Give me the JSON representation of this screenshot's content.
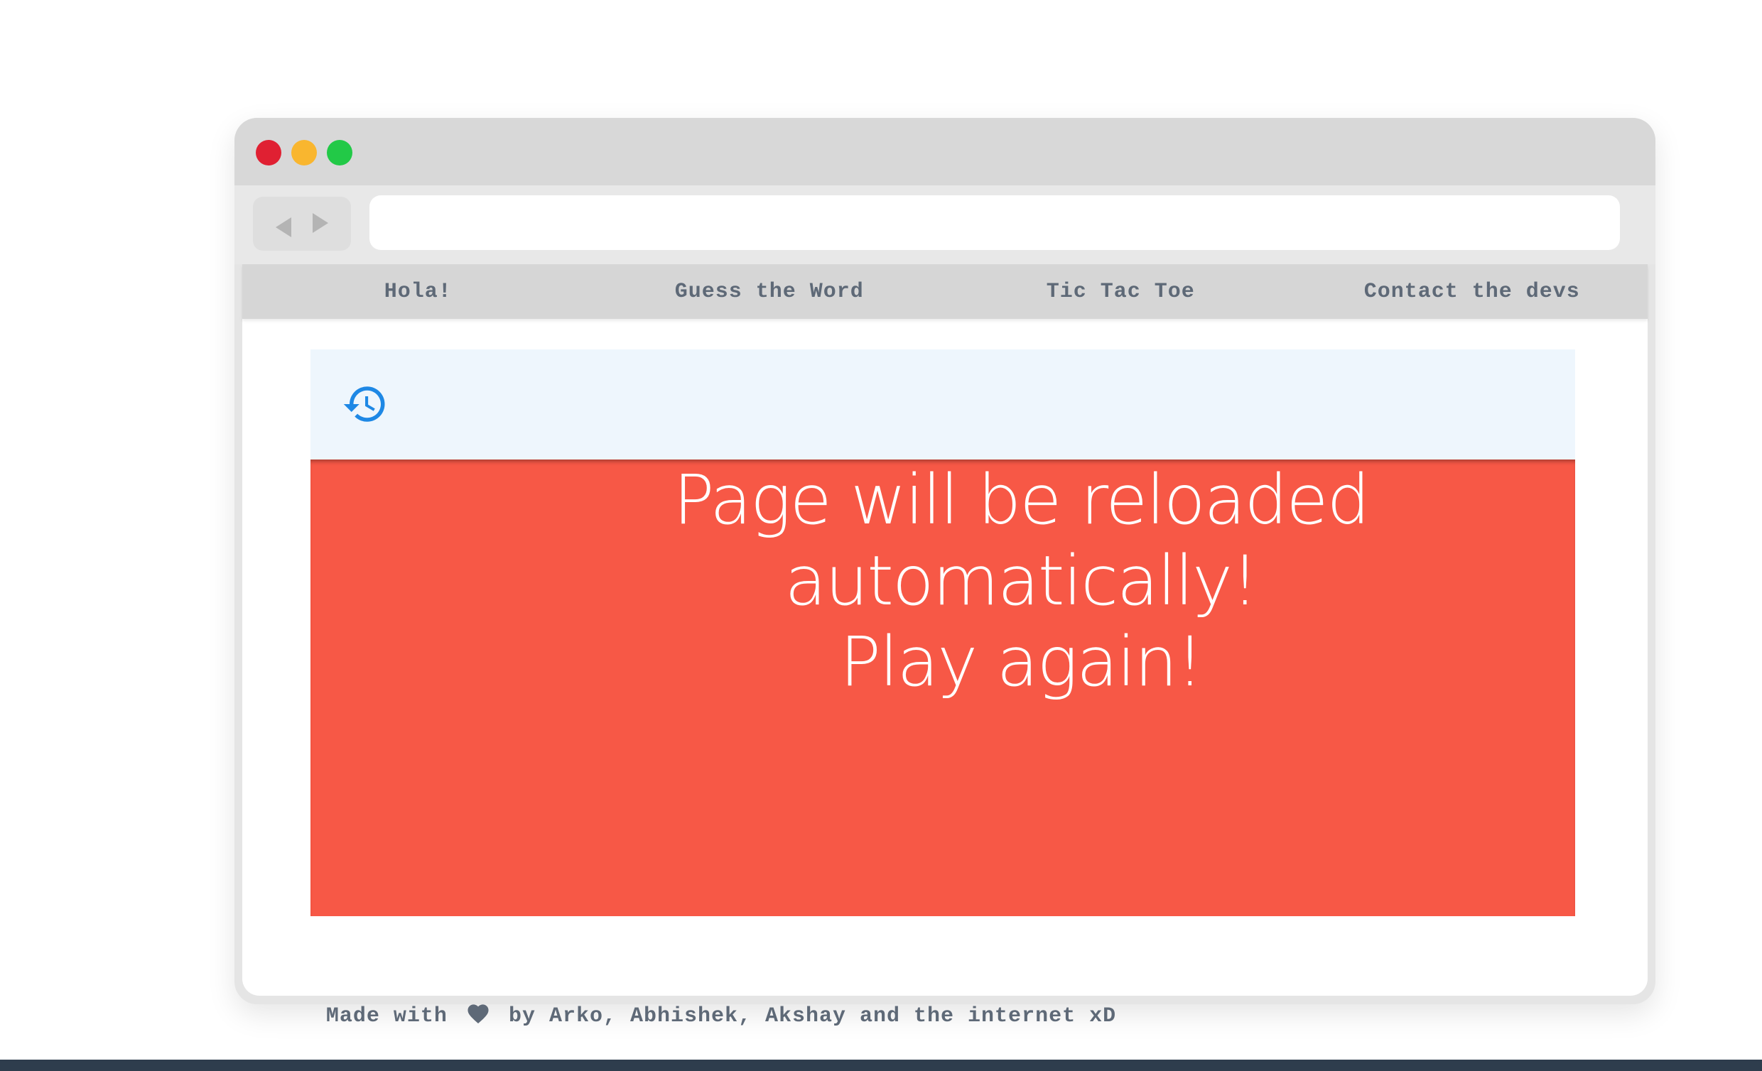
{
  "window": {
    "controls": [
      "close",
      "minimize",
      "maximize"
    ],
    "nav_icons": [
      "back-arrow-icon",
      "forward-arrow-icon"
    ],
    "address_value": ""
  },
  "nav": {
    "items": [
      {
        "label": "Hola!"
      },
      {
        "label": "Guess the Word"
      },
      {
        "label": "Tic Tac Toe"
      },
      {
        "label": "Contact the devs"
      }
    ]
  },
  "game": {
    "header_icon": "history-icon",
    "message_lines": [
      "Page will be reloaded",
      "automatically!",
      "Play again!"
    ]
  },
  "footer": {
    "prefix": "Made with",
    "icon": "heart-icon",
    "suffix": "by Arko, Abhishek, Akshay and the internet xD"
  },
  "colors": {
    "accent_blue": "#1e88e5",
    "alert_red": "#f75846",
    "panel_header_bg": "#eef6fd",
    "nav_text": "#5e6977",
    "close": "#e02032",
    "minimize": "#f9b62f",
    "maximize": "#22c947"
  }
}
